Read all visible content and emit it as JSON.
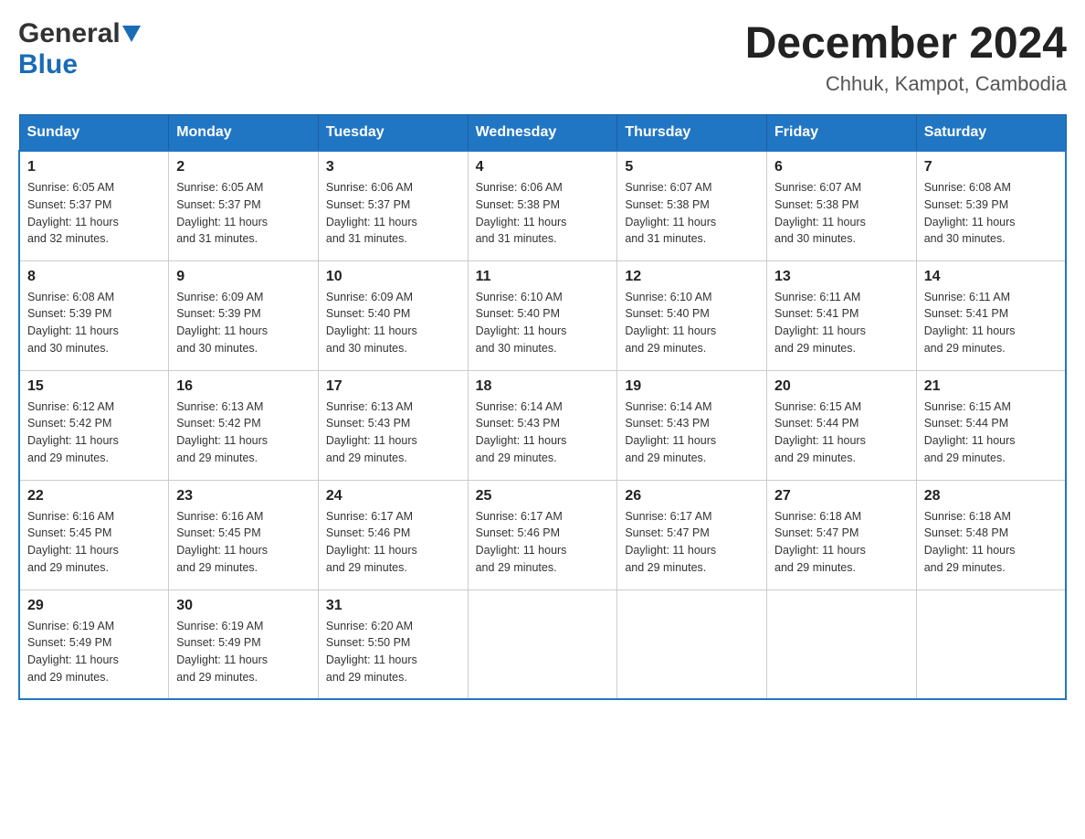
{
  "logo": {
    "general": "General",
    "blue": "Blue"
  },
  "title": "December 2024",
  "location": "Chhuk, Kampot, Cambodia",
  "days_header": [
    "Sunday",
    "Monday",
    "Tuesday",
    "Wednesday",
    "Thursday",
    "Friday",
    "Saturday"
  ],
  "weeks": [
    [
      {
        "day": "1",
        "sunrise": "6:05 AM",
        "sunset": "5:37 PM",
        "daylight": "11 hours and 32 minutes."
      },
      {
        "day": "2",
        "sunrise": "6:05 AM",
        "sunset": "5:37 PM",
        "daylight": "11 hours and 31 minutes."
      },
      {
        "day": "3",
        "sunrise": "6:06 AM",
        "sunset": "5:37 PM",
        "daylight": "11 hours and 31 minutes."
      },
      {
        "day": "4",
        "sunrise": "6:06 AM",
        "sunset": "5:38 PM",
        "daylight": "11 hours and 31 minutes."
      },
      {
        "day": "5",
        "sunrise": "6:07 AM",
        "sunset": "5:38 PM",
        "daylight": "11 hours and 31 minutes."
      },
      {
        "day": "6",
        "sunrise": "6:07 AM",
        "sunset": "5:38 PM",
        "daylight": "11 hours and 30 minutes."
      },
      {
        "day": "7",
        "sunrise": "6:08 AM",
        "sunset": "5:39 PM",
        "daylight": "11 hours and 30 minutes."
      }
    ],
    [
      {
        "day": "8",
        "sunrise": "6:08 AM",
        "sunset": "5:39 PM",
        "daylight": "11 hours and 30 minutes."
      },
      {
        "day": "9",
        "sunrise": "6:09 AM",
        "sunset": "5:39 PM",
        "daylight": "11 hours and 30 minutes."
      },
      {
        "day": "10",
        "sunrise": "6:09 AM",
        "sunset": "5:40 PM",
        "daylight": "11 hours and 30 minutes."
      },
      {
        "day": "11",
        "sunrise": "6:10 AM",
        "sunset": "5:40 PM",
        "daylight": "11 hours and 30 minutes."
      },
      {
        "day": "12",
        "sunrise": "6:10 AM",
        "sunset": "5:40 PM",
        "daylight": "11 hours and 29 minutes."
      },
      {
        "day": "13",
        "sunrise": "6:11 AM",
        "sunset": "5:41 PM",
        "daylight": "11 hours and 29 minutes."
      },
      {
        "day": "14",
        "sunrise": "6:11 AM",
        "sunset": "5:41 PM",
        "daylight": "11 hours and 29 minutes."
      }
    ],
    [
      {
        "day": "15",
        "sunrise": "6:12 AM",
        "sunset": "5:42 PM",
        "daylight": "11 hours and 29 minutes."
      },
      {
        "day": "16",
        "sunrise": "6:13 AM",
        "sunset": "5:42 PM",
        "daylight": "11 hours and 29 minutes."
      },
      {
        "day": "17",
        "sunrise": "6:13 AM",
        "sunset": "5:43 PM",
        "daylight": "11 hours and 29 minutes."
      },
      {
        "day": "18",
        "sunrise": "6:14 AM",
        "sunset": "5:43 PM",
        "daylight": "11 hours and 29 minutes."
      },
      {
        "day": "19",
        "sunrise": "6:14 AM",
        "sunset": "5:43 PM",
        "daylight": "11 hours and 29 minutes."
      },
      {
        "day": "20",
        "sunrise": "6:15 AM",
        "sunset": "5:44 PM",
        "daylight": "11 hours and 29 minutes."
      },
      {
        "day": "21",
        "sunrise": "6:15 AM",
        "sunset": "5:44 PM",
        "daylight": "11 hours and 29 minutes."
      }
    ],
    [
      {
        "day": "22",
        "sunrise": "6:16 AM",
        "sunset": "5:45 PM",
        "daylight": "11 hours and 29 minutes."
      },
      {
        "day": "23",
        "sunrise": "6:16 AM",
        "sunset": "5:45 PM",
        "daylight": "11 hours and 29 minutes."
      },
      {
        "day": "24",
        "sunrise": "6:17 AM",
        "sunset": "5:46 PM",
        "daylight": "11 hours and 29 minutes."
      },
      {
        "day": "25",
        "sunrise": "6:17 AM",
        "sunset": "5:46 PM",
        "daylight": "11 hours and 29 minutes."
      },
      {
        "day": "26",
        "sunrise": "6:17 AM",
        "sunset": "5:47 PM",
        "daylight": "11 hours and 29 minutes."
      },
      {
        "day": "27",
        "sunrise": "6:18 AM",
        "sunset": "5:47 PM",
        "daylight": "11 hours and 29 minutes."
      },
      {
        "day": "28",
        "sunrise": "6:18 AM",
        "sunset": "5:48 PM",
        "daylight": "11 hours and 29 minutes."
      }
    ],
    [
      {
        "day": "29",
        "sunrise": "6:19 AM",
        "sunset": "5:49 PM",
        "daylight": "11 hours and 29 minutes."
      },
      {
        "day": "30",
        "sunrise": "6:19 AM",
        "sunset": "5:49 PM",
        "daylight": "11 hours and 29 minutes."
      },
      {
        "day": "31",
        "sunrise": "6:20 AM",
        "sunset": "5:50 PM",
        "daylight": "11 hours and 29 minutes."
      },
      null,
      null,
      null,
      null
    ]
  ],
  "labels": {
    "sunrise": "Sunrise:",
    "sunset": "Sunset:",
    "daylight": "Daylight:"
  }
}
